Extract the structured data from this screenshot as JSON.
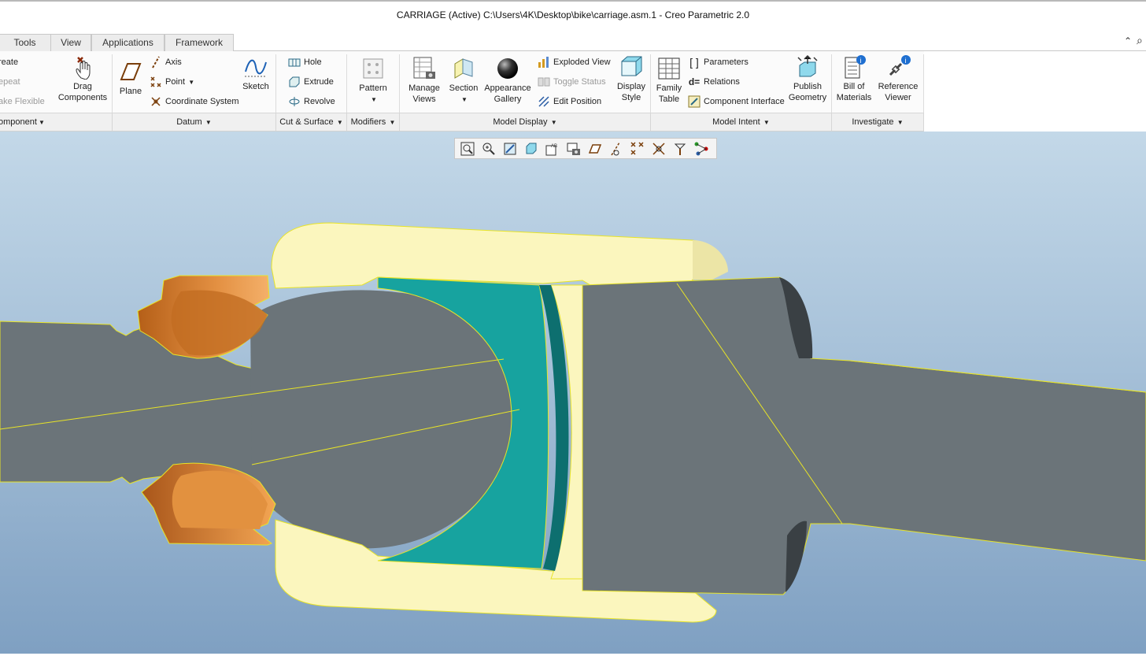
{
  "window": {
    "title": "CARRIAGE (Active) C:\\Users\\4K\\Desktop\\bike\\carriage.asm.1 - Creo Parametric 2.0"
  },
  "tabs": [
    "Tools",
    "View",
    "Applications",
    "Framework"
  ],
  "ribbon": {
    "component": {
      "items": [
        "reate",
        "epeat",
        "ake Flexible"
      ],
      "footer": "omponent"
    },
    "drag": {
      "label": "Drag\nComponents"
    },
    "datum": {
      "plane": "Plane",
      "axis": "Axis",
      "point": "Point",
      "csys": "Coordinate System",
      "sketch": "Sketch",
      "footer": "Datum"
    },
    "cut_surface": {
      "hole": "Hole",
      "extrude": "Extrude",
      "revolve": "Revolve",
      "footer": "Cut & Surface"
    },
    "modifiers": {
      "pattern": "Pattern",
      "footer": "Modifiers"
    },
    "model_display": {
      "manage_views": "Manage\nViews",
      "section": "Section",
      "appearance": "Appearance\nGallery",
      "exploded": "Exploded View",
      "toggle_status": "Toggle Status",
      "edit_position": "Edit Position",
      "display_style": "Display\nStyle",
      "footer": "Model Display"
    },
    "model_intent": {
      "family_table": "Family\nTable",
      "parameters": "Parameters",
      "relations": "Relations",
      "component_interface": "Component Interface",
      "publish_geometry": "Publish\nGeometry",
      "footer": "Model Intent"
    },
    "investigate": {
      "bom": "Bill of\nMaterials",
      "ref_viewer": "Reference\nViewer",
      "footer": "Investigate"
    }
  },
  "colors": {
    "gray_part": "#6c757b",
    "cream_part": "#fbf6bf",
    "teal_part": "#17a3a0",
    "orange_part": "#d9822f",
    "edge": "#f2ee2a"
  }
}
